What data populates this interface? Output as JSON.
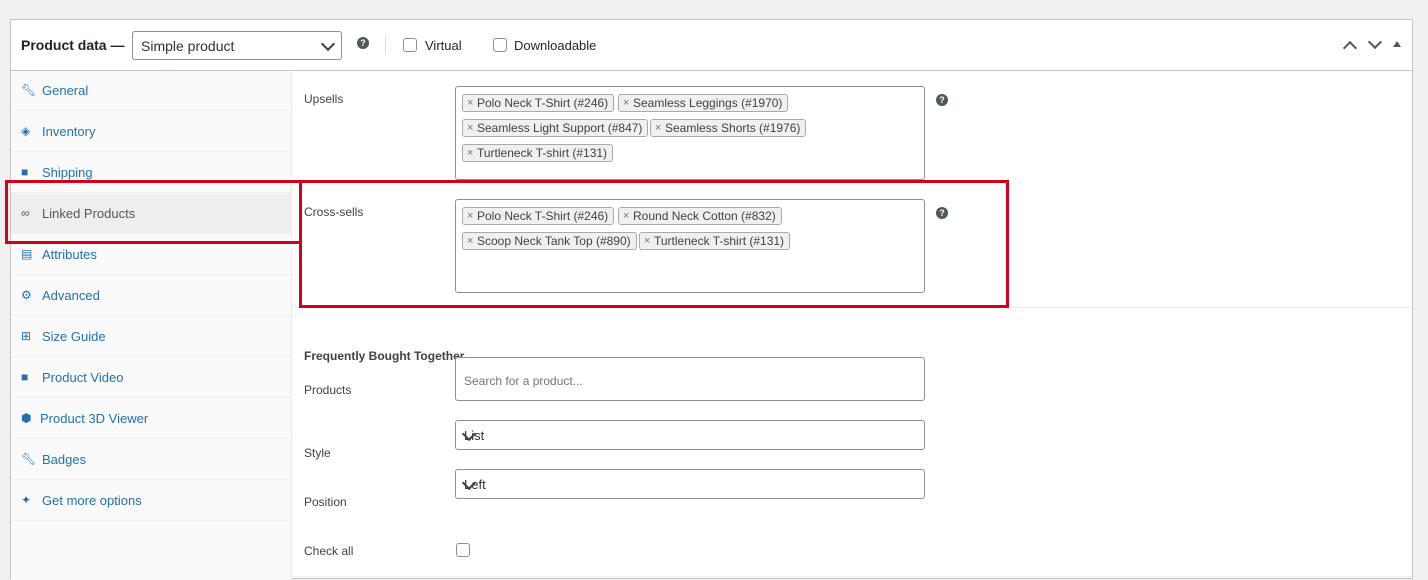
{
  "header": {
    "title": "Product data —",
    "product_type": "Simple product",
    "virtual_label": "Virtual",
    "downloadable_label": "Downloadable"
  },
  "sidebar": {
    "items": [
      {
        "label": "General",
        "icon": "wrench-icon"
      },
      {
        "label": "Inventory",
        "icon": "tag-icon"
      },
      {
        "label": "Shipping",
        "icon": "truck-icon"
      },
      {
        "label": "Linked Products",
        "icon": "link-icon"
      },
      {
        "label": "Attributes",
        "icon": "table-icon"
      },
      {
        "label": "Advanced",
        "icon": "gear-icon"
      },
      {
        "label": "Size Guide",
        "icon": "grid-icon"
      },
      {
        "label": "Product Video",
        "icon": "video-icon"
      },
      {
        "label": "Product 3D Viewer",
        "icon": "cube-icon"
      },
      {
        "label": "Badges",
        "icon": "wrench-icon"
      },
      {
        "label": "Get more options",
        "icon": "plugin-icon"
      }
    ],
    "active": "Linked Products"
  },
  "linked": {
    "upsells_label": "Upsells",
    "upsells": [
      "Polo Neck T-Shirt (#246)",
      "Seamless Leggings (#1970)",
      "Seamless Light Support (#847)",
      "Seamless Shorts (#1976)",
      "Turtleneck T-shirt (#131)"
    ],
    "crosssells_label": "Cross-sells",
    "crosssells": [
      "Polo Neck T-Shirt (#246)",
      "Round Neck Cotton (#832)",
      "Scoop Neck Tank Top (#890)",
      "Turtleneck T-shirt (#131)"
    ]
  },
  "fbt": {
    "title": "Frequently Bought Together",
    "products_label": "Products",
    "products_placeholder": "Search for a product...",
    "style_label": "Style",
    "style_value": "List",
    "position_label": "Position",
    "position_value": "Left",
    "checkall_label": "Check all"
  },
  "colors": {
    "highlight": "#d0021b",
    "link": "#2271b1"
  }
}
